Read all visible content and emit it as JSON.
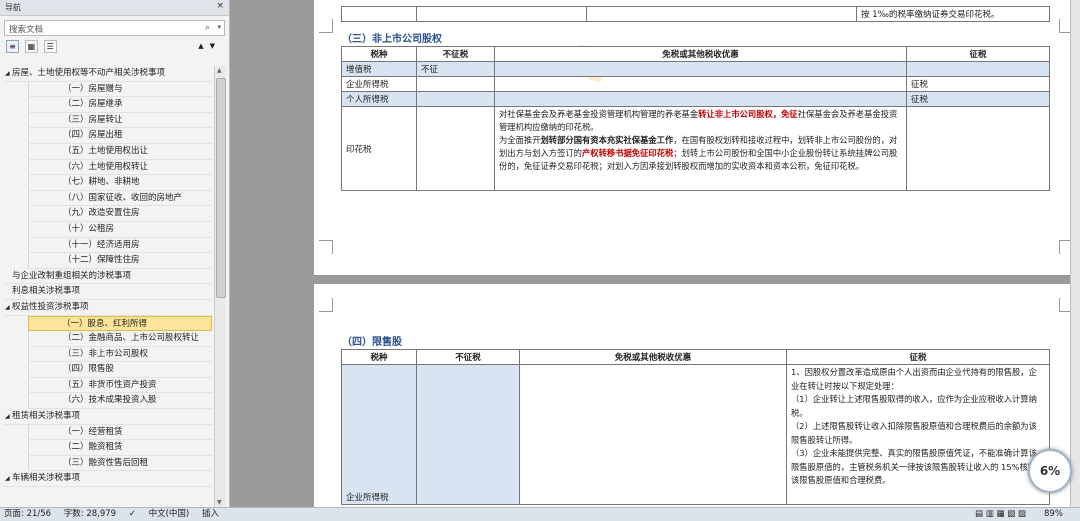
{
  "nav": {
    "title": "导航",
    "close": "×",
    "search_placeholder": "搜索文档",
    "tree": [
      {
        "label": "房屋、土地使用权等不动产相关涉税事项",
        "level": 0,
        "expanded": true
      },
      {
        "label": "（一）房屋赠与",
        "level": 1
      },
      {
        "label": "（二）房屋继承",
        "level": 1
      },
      {
        "label": "（三）房屋转让",
        "level": 1
      },
      {
        "label": "（四）房屋出租",
        "level": 1
      },
      {
        "label": "（五）土地使用权出让",
        "level": 1
      },
      {
        "label": "（六）土地使用权转让",
        "level": 1
      },
      {
        "label": "（七）耕地、非耕地",
        "level": 1
      },
      {
        "label": "（八）国家征收、收回的房地产",
        "level": 1
      },
      {
        "label": "（九）改造安置住房",
        "level": 1
      },
      {
        "label": "（十）公租房",
        "level": 1
      },
      {
        "label": "（十一）经济适用房",
        "level": 1
      },
      {
        "label": "（十二）保障性住房",
        "level": 1
      },
      {
        "label": "与企业改制重组相关的涉税事项",
        "level": 0
      },
      {
        "label": "利息相关涉税事项",
        "level": 0
      },
      {
        "label": "权益性投资涉税事项",
        "level": 0,
        "expanded": true
      },
      {
        "label": "（一）股息、红利所得",
        "level": 1,
        "selected": true
      },
      {
        "label": "（二）金融商品、上市公司股权转让",
        "level": 1
      },
      {
        "label": "（三）非上市公司股权",
        "level": 1
      },
      {
        "label": "（四）限售股",
        "level": 1
      },
      {
        "label": "（五）非货币性资产投资",
        "level": 1
      },
      {
        "label": "（六）技术成果投资入股",
        "level": 1
      },
      {
        "label": "租赁相关涉税事项",
        "level": 0,
        "expanded": true
      },
      {
        "label": "（一）经营租赁",
        "level": 1
      },
      {
        "label": "（二）融资租赁",
        "level": 1
      },
      {
        "label": "（三）融资性售后回租",
        "level": 1
      },
      {
        "label": "车辆相关涉税事项",
        "level": 0,
        "expanded": true
      }
    ]
  },
  "doc": {
    "top_row_text": "按 1‰的税率缴纳证券交易印花税。",
    "section3_title": "（三）非上市公司股权",
    "section3_headers": [
      "税种",
      "不征税",
      "免税或其他税收优惠",
      "征税"
    ],
    "section3_rows": [
      {
        "tax": "增值税",
        "notax": "不征",
        "exempt": "",
        "levy": ""
      },
      {
        "tax": "企业所得税",
        "notax": "",
        "exempt": "",
        "levy": "征税"
      },
      {
        "tax": "个人所得税",
        "notax": "",
        "exempt": "",
        "levy": "征税"
      }
    ],
    "stamp_tax": "印花税",
    "stamp_p1a": "对社保基金会及养老基金投资管理机构管理的养老基金",
    "stamp_p1b": "转让非上市公司股权，免征",
    "stamp_p1c": "社保基金会及养老基金投资管理机构应缴纳的印花税。",
    "stamp_p2a": "为全面推开",
    "stamp_p2b": "划转部分国有资本充实社保基金工作",
    "stamp_p2c": "，在国有股权划转和接收过程中，划转非上市公司股份的，对划出方与划入方签订的",
    "stamp_p2d": "产权转移书据免征印花税",
    "stamp_p2e": "；划转上市公司股份和全国中小企业股份转让系统挂牌公司股份的，免征证券交易印花税；对划入方因承接划转股权而增加的实收资本和资本公积，免征印花税。",
    "section4_title": "（四）限售股",
    "section4_headers": [
      "税种",
      "不征税",
      "免税或其他税收优惠",
      "征税"
    ],
    "section4_tax": "企业所得税",
    "section4_levy_lines": [
      "1、因股权分置改革造成原由个人出资而由企业代持有的限售股，企业在转让时按以下规定处理：",
      "（1）企业转让上述限售股取得的收入，应作为企业应税收入计算纳税。",
      "（2）上述限售股转让收入扣除限售股原值和合理税费后的余额为该限售股转让所得。",
      "（3）企业未能提供完整、真实的限售股原值凭证，不能准确计算该限售股原值的，主管税务机关一律按该限售股转让收入的 15%核定为该限售股原值和合理税费。"
    ]
  },
  "status": {
    "page": "页面: 21/56",
    "words": "字数: 28,979",
    "lang": "中文(中国)",
    "mode": "插入",
    "zoom": "89%",
    "zoom_badge": "6%"
  },
  "colors": {
    "section_title": "#2a4f8f",
    "highlight_row": "#d8e4f2",
    "selected_nav": "#fce59a",
    "emphasis_red": "#c00000"
  }
}
